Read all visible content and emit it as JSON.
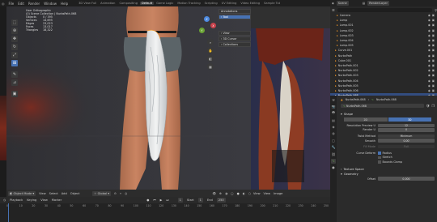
{
  "top_menu": [
    "File",
    "Edit",
    "Render",
    "Window",
    "Help"
  ],
  "workspaces": [
    "3D View Full",
    "Animation",
    "Compositing",
    "Default",
    "Game Logic",
    "Motion Tracking",
    "Scripting",
    "UV Editing",
    "Video Editing",
    "Sample Tut"
  ],
  "active_workspace": "Default",
  "scene": {
    "label": "Scene",
    "layer": "RenderLayer"
  },
  "viewport": {
    "view_name": "User Orthographic",
    "collection": "(0) Scene Collection | NurbsPath.068",
    "stats": [
      {
        "k": "Objects",
        "v": "0 / 395"
      },
      {
        "k": "Vertices",
        "v": "14,695"
      },
      {
        "k": "Edges",
        "v": "23,023"
      },
      {
        "k": "Faces",
        "v": "13,017"
      },
      {
        "k": "Triangles",
        "v": "18,322"
      }
    ],
    "annotations": "Annotations",
    "npanel": [
      "Tool",
      "View",
      "3D Cursor",
      "Collections"
    ],
    "header": [
      "Object Mode",
      "View",
      "Select",
      "Add",
      "Object",
      "Global"
    ],
    "right_header": [
      "View",
      "View",
      "Image"
    ]
  },
  "outliner": {
    "rows": [
      {
        "name": "Camera",
        "sel": false
      },
      {
        "name": "Lamp",
        "sel": false
      },
      {
        "name": "Lamp.001",
        "sel": false
      },
      {
        "name": "Lamp.002",
        "sel": false
      },
      {
        "name": "Lamp.003",
        "sel": false
      },
      {
        "name": "Lamp.004",
        "sel": false
      },
      {
        "name": "Lamp.005",
        "sel": false
      },
      {
        "name": "Curve.001",
        "sel": false
      },
      {
        "name": "NurbsPath",
        "sel": false
      },
      {
        "name": "Cube.001",
        "sel": false
      },
      {
        "name": "NurbsPath.001",
        "sel": false
      },
      {
        "name": "NurbsPath.002",
        "sel": false
      },
      {
        "name": "NurbsPath.003",
        "sel": false
      },
      {
        "name": "NurbsPath.004",
        "sel": false
      },
      {
        "name": "NurbsPath.005",
        "sel": false
      },
      {
        "name": "NurbsPath.006",
        "sel": false
      },
      {
        "name": "NurbsPath.068",
        "sel": true
      }
    ]
  },
  "properties": {
    "breadcrumb": [
      "NurbsPath.068",
      "NurbsPath.068"
    ],
    "datablock": "NurbsPath.068",
    "shape_section": "Shape",
    "dims": [
      "2D",
      "3D"
    ],
    "active_dim": "3D",
    "fields": [
      {
        "label": "Resolution Preview U",
        "value": "12"
      },
      {
        "label": "Render U",
        "value": "0"
      }
    ],
    "twist_method": {
      "label": "Twist Method",
      "value": "Minimum"
    },
    "smooth": {
      "label": "Smooth",
      "value": "0.00"
    },
    "fill_mode": {
      "label": "Fill Mode",
      "value": "Full"
    },
    "curve_deform": {
      "label": "Curve Deform",
      "options": [
        "Radius",
        "Stretch",
        "Bounds Clamp"
      ]
    },
    "sections": [
      "Texture Space",
      "Geometry"
    ],
    "offset": {
      "label": "Offset",
      "value": "0.000"
    }
  },
  "timeline": {
    "menus": [
      "Playback",
      "Keying",
      "View",
      "Marker"
    ],
    "start": {
      "label": "Start",
      "value": "1"
    },
    "end": {
      "label": "End",
      "value": "250"
    },
    "frame": "1",
    "ticks": [
      "0",
      "10",
      "20",
      "30",
      "40",
      "50",
      "60",
      "70",
      "80",
      "90",
      "100",
      "110",
      "120",
      "130",
      "140",
      "150",
      "160",
      "170",
      "180",
      "190",
      "200",
      "210",
      "220",
      "230",
      "240",
      "250"
    ]
  },
  "colors": {
    "accent": "#4772b3",
    "selected_row": "#334d80",
    "header_bg": "#1f1f1f"
  }
}
